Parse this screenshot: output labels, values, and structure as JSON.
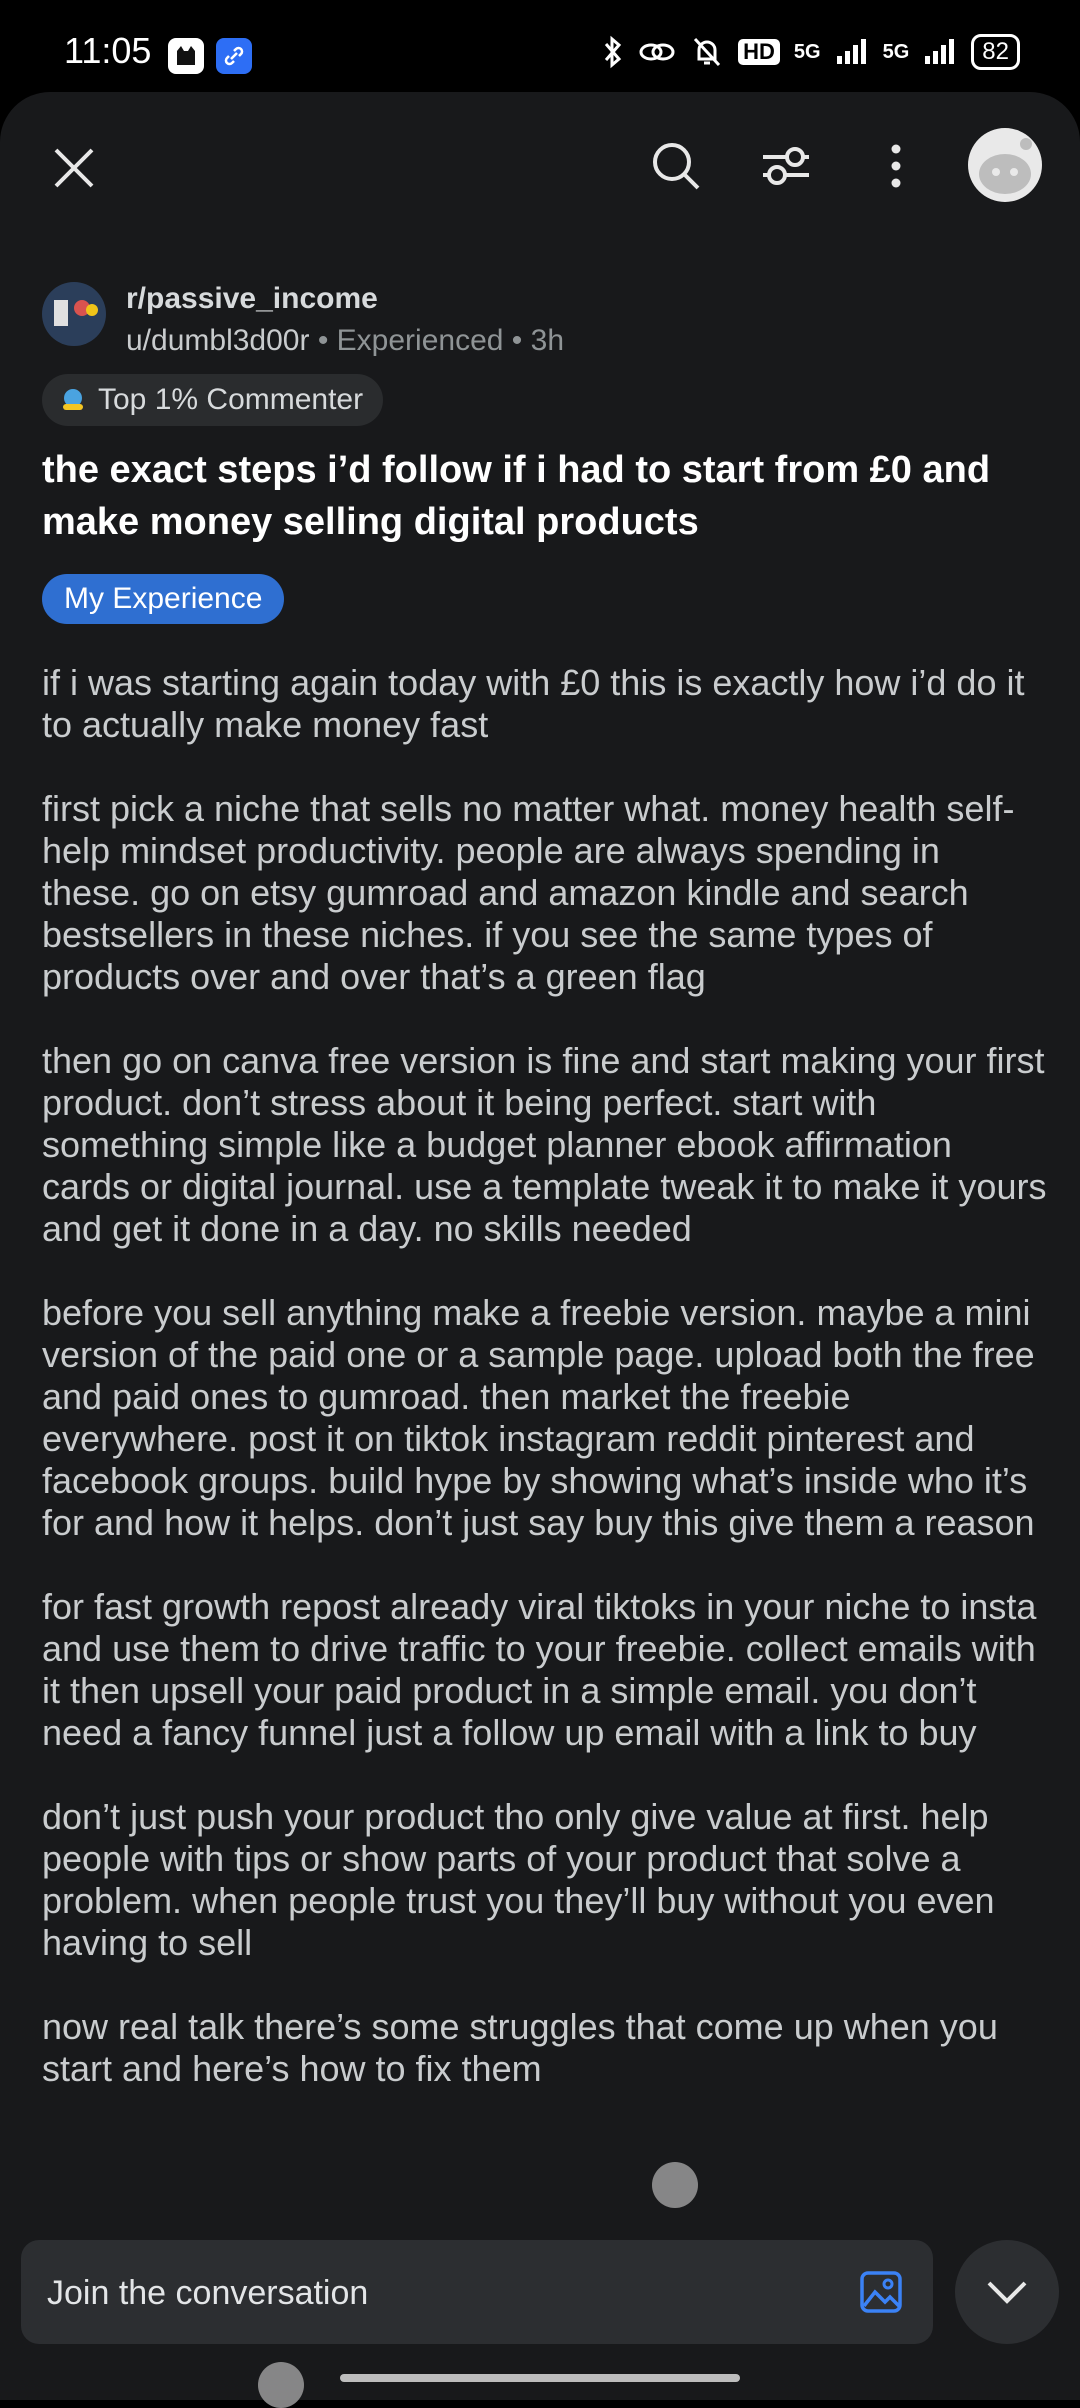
{
  "status_bar": {
    "time": "11:05",
    "network": "5G",
    "network2": "5G",
    "hd": "HD",
    "battery": "82"
  },
  "topbar": {
    "close_icon": "close-icon",
    "search_icon": "search-icon",
    "sort_icon": "sort-icon",
    "more_icon": "more-vertical-icon"
  },
  "post": {
    "subreddit": "r/passive_income",
    "username": "u/dumbl3d00r",
    "user_level": "Experienced",
    "age": "3h",
    "separator": "•",
    "user_flair": "Top 1% Commenter",
    "title": "the exact steps i’d follow if i had to start from £0 and make money selling digital products",
    "post_flair": "My Experience",
    "paragraphs": [
      "if i was starting again today with £0 this is exactly how i’d do it to actually make money fast",
      "first pick a niche that sells no matter what. money health self-help mindset productivity. people are always spending in these. go on etsy gumroad and amazon kindle and search bestsellers in these niches. if you see the same types of products over and over that’s a green flag",
      "then go on canva free version is fine and start making your first product. don’t stress about it being perfect. start with something simple like a budget planner ebook affirmation cards or digital journal. use a template tweak it to make it yours and get it done in a day. no skills needed",
      "before you sell anything make a freebie version. maybe a mini version of the paid one or a sample page. upload both the free and paid ones to gumroad. then market the freebie everywhere. post it on tiktok instagram reddit pinterest and facebook groups. build hype by showing what’s inside who it’s for and how it helps. don’t just say buy this give them a reason",
      "for fast growth repost already viral tiktoks in your niche to insta and use them to drive traffic to your freebie. collect emails with it then upsell your paid product in a simple email. you don’t need a fancy funnel just a follow up email with a link to buy",
      "don’t just push your product tho only give value at first. help people with tips or show parts of your product that solve a problem. when people trust you they’ll buy without you even having to sell",
      "now real talk there’s some struggles that come up when you start and here’s how to fix them"
    ]
  },
  "composer": {
    "placeholder": "Join the conversation",
    "image_icon": "image-icon",
    "collapse_icon": "chevron-down-icon"
  },
  "colors": {
    "accent_blue": "#2f6fd1",
    "background": "#18191b"
  }
}
